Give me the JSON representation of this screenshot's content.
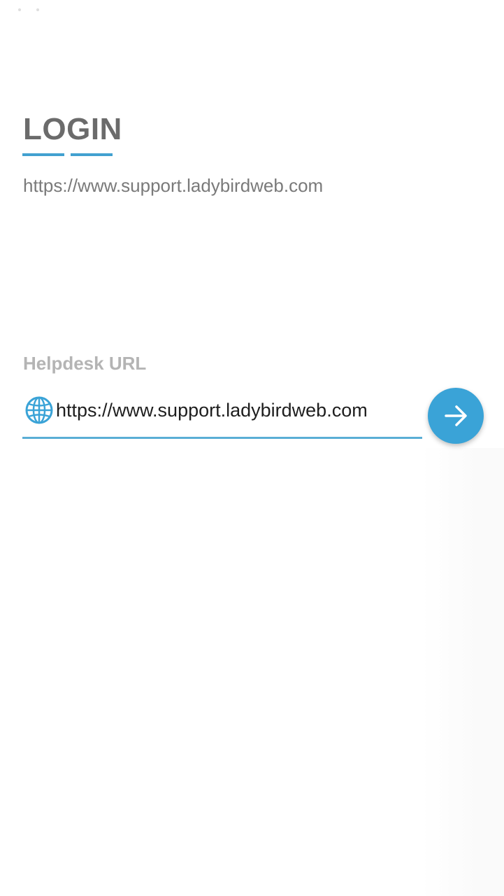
{
  "login": {
    "title": "LOGIN",
    "current_url": "https://www.support.ladybirdweb.com"
  },
  "helpdesk_url": {
    "label": "Helpdesk URL",
    "value": "https://www.support.ladybirdweb.com",
    "icon": "globe-icon"
  },
  "submit": {
    "icon": "arrow-right-icon"
  },
  "colors": {
    "accent": "#3aa3d7",
    "title": "#6b6b6b",
    "label": "#b4b4b4",
    "underline": "#42a1d0"
  }
}
